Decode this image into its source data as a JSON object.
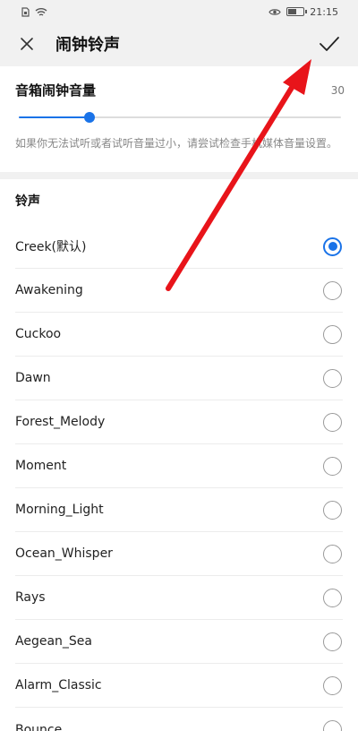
{
  "status_bar": {
    "time": "21:15",
    "battery_level": 0.6,
    "icons": [
      "sim-icon",
      "wifi-icon",
      "eye-icon",
      "battery-icon"
    ]
  },
  "header": {
    "title": "闹钟铃声",
    "close_icon": "close-icon",
    "confirm_icon": "check-icon"
  },
  "volume": {
    "label": "音箱闹钟音量",
    "value": "30",
    "slider_fraction": 0.22,
    "hint": "如果你无法试听或者试听音量过小，请尝试检查手机媒体音量设置。"
  },
  "ringtones": {
    "section_title": "铃声",
    "selected_index": 0,
    "items": [
      "Creek(默认)",
      "Awakening",
      "Cuckoo",
      "Dawn",
      "Forest_Melody",
      "Moment",
      "Morning_Light",
      "Ocean_Whisper",
      "Rays",
      "Aegean_Sea",
      "Alarm_Classic",
      "Bounce"
    ]
  },
  "colors": {
    "accent": "#1a73e8",
    "annotation_arrow": "#e8141a"
  }
}
